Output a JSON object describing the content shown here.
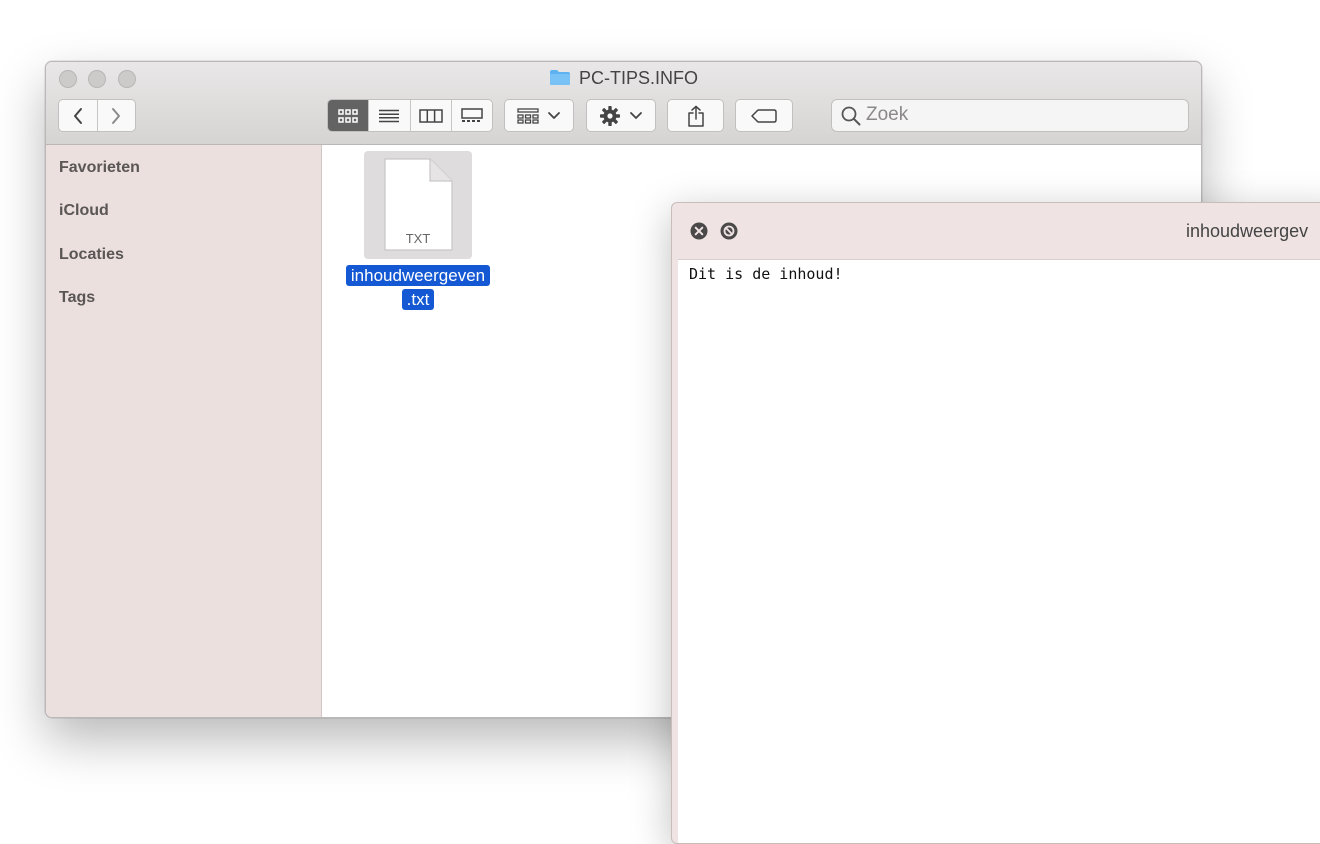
{
  "finder": {
    "title": "PC-TIPS.INFO",
    "search": {
      "placeholder": "Zoek"
    },
    "sidebar": {
      "items": [
        {
          "label": "Favorieten"
        },
        {
          "label": "iCloud"
        },
        {
          "label": "Locaties"
        },
        {
          "label": "Tags"
        }
      ]
    },
    "file": {
      "type_label": "TXT",
      "name_line1": "inhoudweergeven",
      "name_line2": ".txt"
    },
    "icons": {
      "back": "chevron-left-icon",
      "forward": "chevron-right-icon",
      "view_icons": "grid-icon",
      "view_list": "list-icon",
      "view_columns": "columns-icon",
      "view_gallery": "gallery-icon",
      "group": "group-icon",
      "action": "gear-icon",
      "share": "share-icon",
      "tag": "tag-icon",
      "search": "search-icon"
    }
  },
  "quicklook": {
    "title": "inhoudweergev",
    "content": "Dit is de inhoud!"
  },
  "colors": {
    "selection": "#1459d3",
    "sidebar_bg": "#ebe0de",
    "active_view": "#646363",
    "folder": "#5eb2f0"
  }
}
